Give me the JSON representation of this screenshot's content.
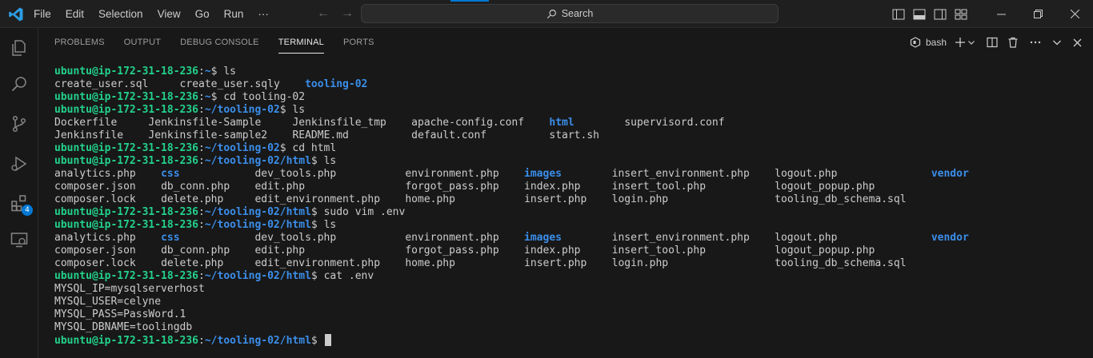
{
  "titlebar": {
    "menu": [
      "File",
      "Edit",
      "Selection",
      "View",
      "Go",
      "Run",
      "···"
    ],
    "search_placeholder": "Search"
  },
  "activity_bar": {
    "icons": [
      "explorer-icon",
      "search-icon",
      "source-control-icon",
      "run-debug-icon",
      "extensions-icon",
      "remote-explorer-icon"
    ],
    "extensions_badge": "4"
  },
  "panel": {
    "tabs": [
      "PROBLEMS",
      "OUTPUT",
      "DEBUG CONSOLE",
      "TERMINAL",
      "PORTS"
    ],
    "active_tab": "TERMINAL",
    "shell_label": "bash"
  },
  "terminal": {
    "user_host": "ubuntu@ip-172-31-18-236",
    "lines": [
      {
        "type": "prompt",
        "path": "~",
        "cmd": "ls"
      },
      {
        "type": "out",
        "cols": [
          {
            "t": "create_user.sql",
            "w": 18
          },
          {
            "t": "create_user.sqly",
            "w": 18
          },
          {
            "t": "tooling-02",
            "w": 10,
            "dir": true
          }
        ]
      },
      {
        "type": "prompt",
        "path": "~",
        "cmd": "cd tooling-02"
      },
      {
        "type": "prompt",
        "path": "~/tooling-02",
        "cmd": "ls"
      },
      {
        "type": "out",
        "cols": [
          {
            "t": "Dockerfile",
            "w": 13
          },
          {
            "t": "Jenkinsfile-Sample",
            "w": 21
          },
          {
            "t": "Jenkinsfile_tmp",
            "w": 17
          },
          {
            "t": "apache-config.conf",
            "w": 20
          },
          {
            "t": "html",
            "w": 10,
            "dir": true
          },
          {
            "t": "supervisord.conf",
            "w": 16
          }
        ]
      },
      {
        "type": "out",
        "cols": [
          {
            "t": "Jenkinsfile",
            "w": 13
          },
          {
            "t": "Jenkinsfile-sample2",
            "w": 21
          },
          {
            "t": "README.md",
            "w": 17
          },
          {
            "t": "default.conf",
            "w": 20
          },
          {
            "t": "start.sh",
            "w": 10
          }
        ]
      },
      {
        "type": "prompt",
        "path": "~/tooling-02",
        "cmd": "cd html"
      },
      {
        "type": "prompt",
        "path": "~/tooling-02/html",
        "cmd": "ls"
      },
      {
        "type": "out",
        "cols": [
          {
            "t": "analytics.php",
            "w": 15
          },
          {
            "t": "css",
            "w": 13,
            "dir": true
          },
          {
            "t": "dev_tools.php",
            "w": 22
          },
          {
            "t": "environment.php",
            "w": 17
          },
          {
            "t": "images",
            "w": 12,
            "dir": true
          },
          {
            "t": "insert_environment.php",
            "w": 24
          },
          {
            "t": "logout.php",
            "w": 23
          },
          {
            "t": "vendor",
            "w": 6,
            "dir": true
          }
        ]
      },
      {
        "type": "out",
        "cols": [
          {
            "t": "composer.json",
            "w": 15
          },
          {
            "t": "db_conn.php",
            "w": 13
          },
          {
            "t": "edit.php",
            "w": 22
          },
          {
            "t": "forgot_pass.php",
            "w": 17
          },
          {
            "t": "index.php",
            "w": 12
          },
          {
            "t": "insert_tool.php",
            "w": 24
          },
          {
            "t": "logout_popup.php",
            "w": 23
          }
        ]
      },
      {
        "type": "out",
        "cols": [
          {
            "t": "composer.lock",
            "w": 15
          },
          {
            "t": "delete.php",
            "w": 13
          },
          {
            "t": "edit_environment.php",
            "w": 22
          },
          {
            "t": "home.php",
            "w": 17
          },
          {
            "t": "insert.php",
            "w": 12
          },
          {
            "t": "login.php",
            "w": 24
          },
          {
            "t": "tooling_db_schema.sql",
            "w": 23
          }
        ]
      },
      {
        "type": "prompt",
        "path": "~/tooling-02/html",
        "cmd": "sudo vim .env"
      },
      {
        "type": "prompt",
        "path": "~/tooling-02/html",
        "cmd": "ls"
      },
      {
        "type": "out",
        "cols": [
          {
            "t": "analytics.php",
            "w": 15
          },
          {
            "t": "css",
            "w": 13,
            "dir": true
          },
          {
            "t": "dev_tools.php",
            "w": 22
          },
          {
            "t": "environment.php",
            "w": 17
          },
          {
            "t": "images",
            "w": 12,
            "dir": true
          },
          {
            "t": "insert_environment.php",
            "w": 24
          },
          {
            "t": "logout.php",
            "w": 23
          },
          {
            "t": "vendor",
            "w": 6,
            "dir": true
          }
        ]
      },
      {
        "type": "out",
        "cols": [
          {
            "t": "composer.json",
            "w": 15
          },
          {
            "t": "db_conn.php",
            "w": 13
          },
          {
            "t": "edit.php",
            "w": 22
          },
          {
            "t": "forgot_pass.php",
            "w": 17
          },
          {
            "t": "index.php",
            "w": 12
          },
          {
            "t": "insert_tool.php",
            "w": 24
          },
          {
            "t": "logout_popup.php",
            "w": 23
          }
        ]
      },
      {
        "type": "out",
        "cols": [
          {
            "t": "composer.lock",
            "w": 15
          },
          {
            "t": "delete.php",
            "w": 13
          },
          {
            "t": "edit_environment.php",
            "w": 22
          },
          {
            "t": "home.php",
            "w": 17
          },
          {
            "t": "insert.php",
            "w": 12
          },
          {
            "t": "login.php",
            "w": 24
          },
          {
            "t": "tooling_db_schema.sql",
            "w": 23
          }
        ]
      },
      {
        "type": "prompt",
        "path": "~/tooling-02/html",
        "cmd": "cat .env"
      },
      {
        "type": "text",
        "t": "MYSQL_IP=mysqlserverhost"
      },
      {
        "type": "text",
        "t": "MYSQL_USER=celyne"
      },
      {
        "type": "text",
        "t": "MYSQL_PASS=PassWord.1"
      },
      {
        "type": "text",
        "t": "MYSQL_DBNAME=toolingdb"
      },
      {
        "type": "prompt",
        "path": "~/tooling-02/html",
        "cmd": "",
        "cursor": true
      }
    ]
  },
  "colors": {
    "prompt_user": "#23d18b",
    "prompt_path": "#3b8eea",
    "directory": "#3b8eea",
    "accent": "#0078d4"
  }
}
